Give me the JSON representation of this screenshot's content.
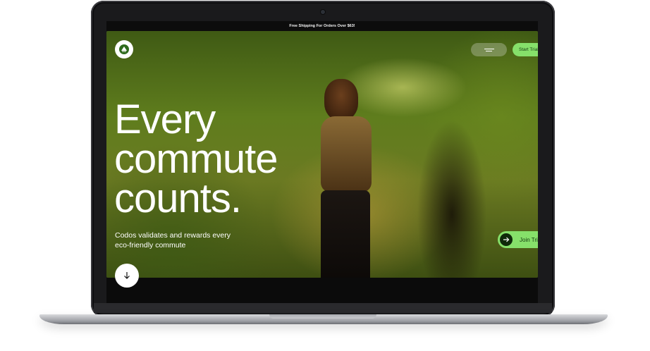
{
  "announcement": "Free Shipping For Orders Over $63!",
  "nav": {
    "logo_icon": "codos-logo-icon",
    "menu_icon": "hamburger-menu-icon",
    "cta_label": "Start Trial"
  },
  "hero": {
    "headline_line1": "Every",
    "headline_line2": "commute",
    "headline_line3": "counts.",
    "subtext": "Codos validates and rewards every eco-friendly commute",
    "scroll_icon": "arrow-down-icon",
    "join_label": "Join Trial",
    "join_icon": "arrow-right-icon"
  },
  "colors": {
    "accent_green": "#86e06a",
    "dark": "#0f2a0a"
  }
}
